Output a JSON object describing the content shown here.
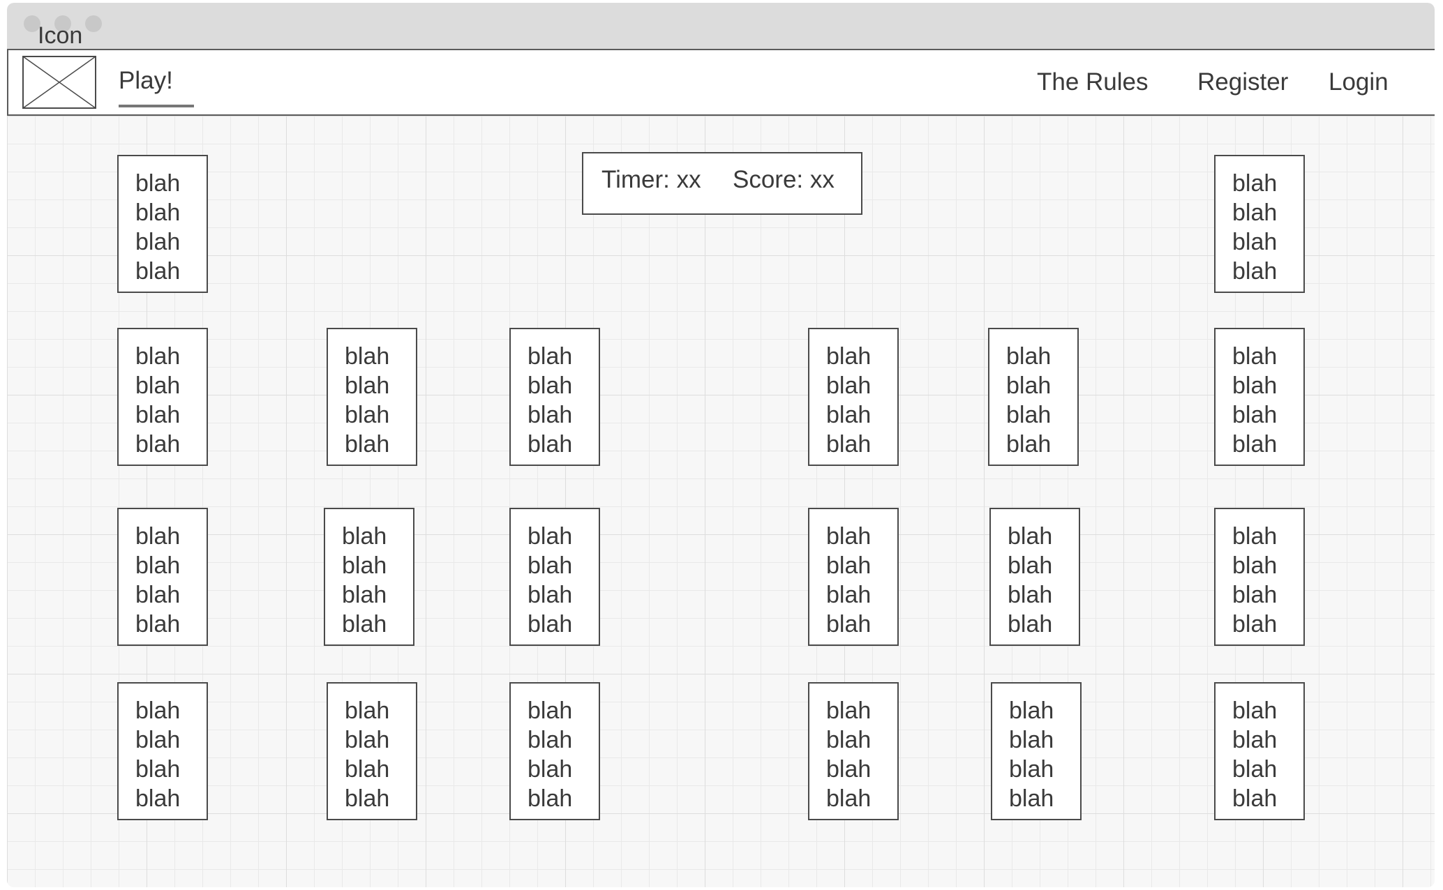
{
  "window": {
    "title": "Icon"
  },
  "navbar": {
    "logo_icon": "image-placeholder-icon",
    "play_label": "Play!",
    "rules_label": "The Rules",
    "register_label": "Register",
    "login_label": "Login"
  },
  "status": {
    "timer_text": "Timer: xx",
    "score_text": "Score: xx"
  },
  "cards": {
    "lines": [
      "blah",
      "blah",
      "blah",
      "blah"
    ]
  },
  "colors": {
    "border": "#4a4a4a",
    "text": "#3a3a3a",
    "titlebar": "#dcdcdc",
    "grid": "#dddddd"
  }
}
